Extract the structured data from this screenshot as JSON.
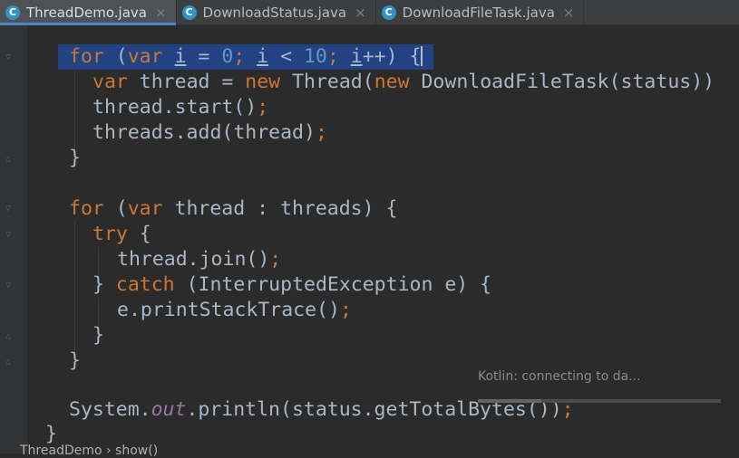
{
  "tabs": [
    {
      "label": "ThreadDemo.java",
      "active": true,
      "icon": "class-icon",
      "icon_letter": "C"
    },
    {
      "label": "DownloadStatus.java",
      "active": false,
      "icon": "class-icon",
      "icon_letter": "C"
    },
    {
      "label": "DownloadFileTask.java",
      "active": false,
      "icon": "class-icon",
      "icon_letter": "C"
    }
  ],
  "tab_close_glyph": "×",
  "code": {
    "l1": {
      "kw_for": "for",
      "p1": " (",
      "kw_var": "var",
      "sp1": " ",
      "i1": "i",
      "eq": " = ",
      "n0": "0",
      "semi1": "; ",
      "i2": "i",
      "lt": " < ",
      "n10": "10",
      "semi2": "; ",
      "i3": "i",
      "inc": "++) {"
    },
    "l2": {
      "kw_var": "var",
      "mid": " thread = ",
      "kw_new1": "new",
      "mid2": " Thread(",
      "kw_new2": "new",
      "rest": " DownloadFileTask(status))"
    },
    "l3": {
      "text": "thread.start()",
      "semi": ";"
    },
    "l4": {
      "text": "threads.add(thread)",
      "semi": ";"
    },
    "l5": {
      "text": "}"
    },
    "l6": {
      "kw_for": "for",
      "p1": " (",
      "kw_var": "var",
      "rest": " thread : threads) {"
    },
    "l7": {
      "kw_try": "try",
      "rest": " {"
    },
    "l8": {
      "text": "thread.join()",
      "semi": ";"
    },
    "l9": {
      "pre": "} ",
      "kw_catch": "catch",
      "rest": " (InterruptedException e) {"
    },
    "l10": {
      "text": "e.printStackTrace()",
      "semi": ";"
    },
    "l11": {
      "text": "}"
    },
    "l12": {
      "text": "}"
    },
    "l13": {
      "pre": "System.",
      "out": "out",
      "rest": ".println(status.getTotalBytes())",
      "semi": ";"
    },
    "l14": {
      "text": "}"
    }
  },
  "status_popup": {
    "text": "Kotlin: connecting to da...",
    "progress": 0.26
  },
  "breadcrumb": {
    "text": "ThreadDemo  ›  show()"
  },
  "colors": {
    "keyword": "#cc7832",
    "number": "#6897bb",
    "field": "#9876aa",
    "text": "#a9b7c6",
    "selection": "#214283",
    "background": "#2b2b2b"
  }
}
